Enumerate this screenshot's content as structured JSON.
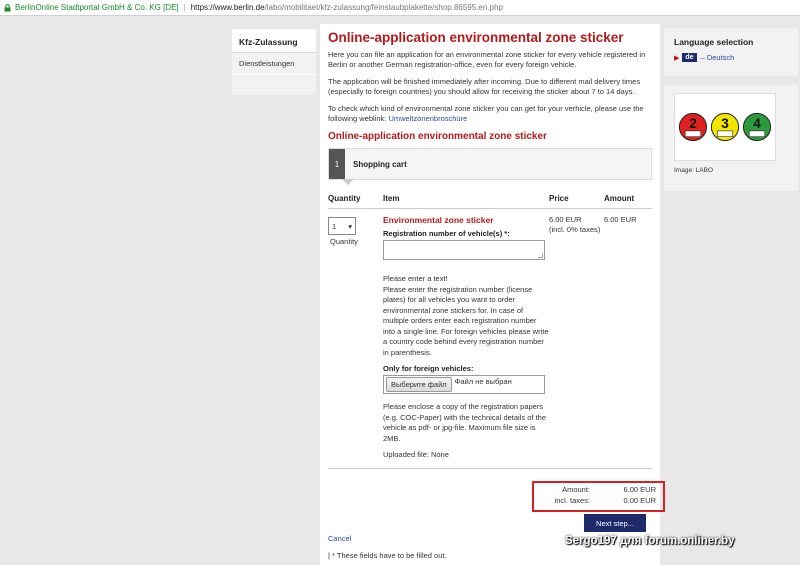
{
  "browser": {
    "site_identity": "BerlinOnline Stadtportal GmbH & Co. KG [DE]",
    "url_host": "https://www.berlin.de",
    "url_path": "/labo/mobilitaet/kfz-zulassung/feinstaubplakette/shop.86595.en.php"
  },
  "leftnav": {
    "heading": "Kfz-Zulassung",
    "items": [
      "Dienstleistungen"
    ]
  },
  "main": {
    "title": "Online-application environmental zone sticker",
    "intro_1": "Here you can file an application for an environmental zone sticker for every vehicle registered in Berlin or another German registration-office, even for every foreign vehicle.",
    "intro_2": "The application will be finished immediately after incoming. Due to different mail delivery times (especially to foreign countries) you should allow for receiving the sticker about 7 to 14 days.",
    "intro_3_text": "To check which kind of environmental zone sticker you can get for your verhicle, please use the following weblink:",
    "intro_3_link": "Umweltzonenbroschüre",
    "subtitle": "Online-application environmental zone sticker",
    "step": {
      "number": "1",
      "label": "Shopping cart"
    },
    "cart": {
      "headers": {
        "quantity": "Quantity",
        "item": "Item",
        "price": "Price",
        "amount": "Amount"
      },
      "quantity_value": "1",
      "quantity_label": "Quantity",
      "item_title": "Environmental zone sticker",
      "reg_label": "Registration number of vehicle(s) *:",
      "help_text_1": "Please enter a text!",
      "help_text_2": "Please enter the registration number (license plates) for all vehicles you want to order environmental zone stickers for. In case of multiple orders enter each registration number into a single line. For foreign vehicles please write a country code behind every registration number in parenthesis.",
      "foreign_label": "Only for foreign vehicles:",
      "file_button": "Выберите файл",
      "file_none": "Файл не выбран",
      "help_text_3": "Please enclose a copy of the registration papers (e.g. COC-Paper) with the technical details of the vehicle as pdf- or jpg-file. Maximum file size is 2MB.",
      "uploaded": "Uploaded file: None",
      "price": "6.00 EUR",
      "price_note": "(incl. 0% taxes)",
      "amount": "6.00 EUR"
    },
    "totals": {
      "amount_label": "Amount:",
      "amount_value": "6.00 EUR",
      "taxes_label": "incl. taxes:",
      "taxes_value": "0.00 EUR"
    },
    "next_button": "Next step...",
    "cancel_link": "Cancel",
    "required_note": "| * These fields have to be filled out."
  },
  "right": {
    "language_title": "Language selection",
    "language_badge": "de",
    "language_link": "– Deutsch",
    "image_caption": "Image: LABO",
    "sticker_numbers": [
      "2",
      "3",
      "4"
    ]
  },
  "watermark": "Sergo197 для forum.onliner.by",
  "colors": {
    "accent_red": "#b51a1a",
    "button_navy": "#1d2a6b",
    "link_blue": "#2a4aa8",
    "highlight_red": "#d92020",
    "secure_green": "#1a8a2a"
  }
}
